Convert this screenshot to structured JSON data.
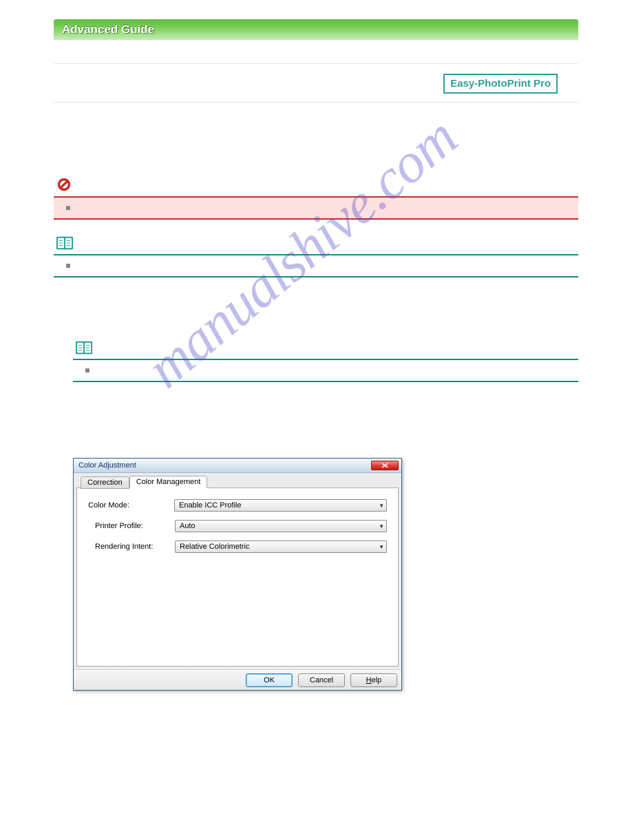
{
  "watermark": "manualshive.com",
  "header": {
    "title": "Advanced Guide"
  },
  "badge": {
    "app": "Easy-PhotoPrint Pro"
  },
  "dialog": {
    "title": "Color Adjustment",
    "close_label": "X",
    "tabs": {
      "correction": "Correction",
      "color_mgmt": "Color Management"
    },
    "fields": {
      "color_mode_label": "Color Mode:",
      "color_mode_value": "Enable ICC Profile",
      "printer_profile_label": "Printer Profile:",
      "printer_profile_value": "Auto",
      "rendering_intent_label": "Rendering Intent:",
      "rendering_intent_value": "Relative Colorimetric"
    },
    "buttons": {
      "ok": "OK",
      "cancel": "Cancel",
      "help": "Help",
      "help_key": "H"
    }
  }
}
